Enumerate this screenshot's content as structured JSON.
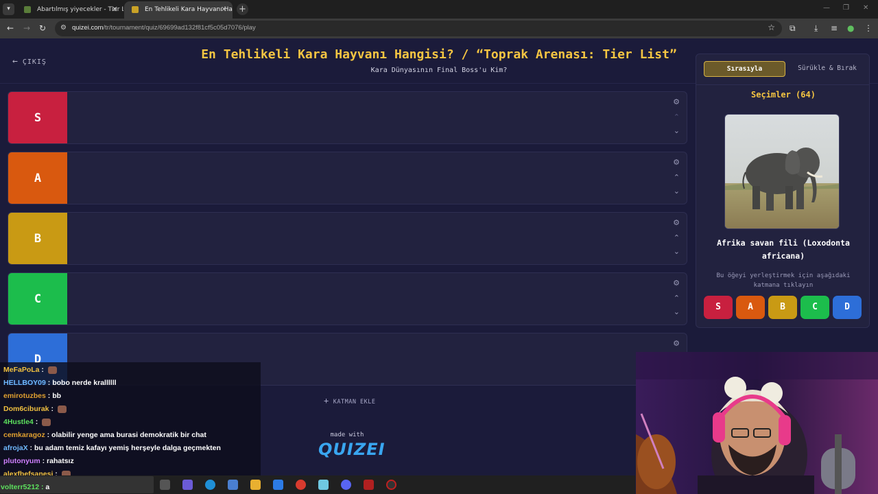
{
  "browser": {
    "tabs": [
      {
        "title": "Abartılmış yiyecekler - Tier List |"
      },
      {
        "title": "En Tehlikeli Kara Hayvanı Hangi"
      }
    ],
    "url_domain": "quizei.com",
    "url_path": "/tr/tournament/quiz/69699ad132f81cf5c05d7076/play"
  },
  "header": {
    "exit_label": "ÇIKIŞ",
    "title": "En Tehlikeli Kara Hayvanı Hangisi? / “Toprak Arenası: Tier List”",
    "subtitle": "Kara Dünyasının Final Boss'u Kim?"
  },
  "tiers": [
    {
      "label": "S",
      "color": "#c8203f"
    },
    {
      "label": "A",
      "color": "#d9590f"
    },
    {
      "label": "B",
      "color": "#c99a14"
    },
    {
      "label": "C",
      "color": "#1cbd4c"
    },
    {
      "label": "D",
      "color": "#2d6ed8"
    }
  ],
  "add_layer_label": "KATMAN EKLE",
  "made_with": "made with",
  "brand": "QUIZEI",
  "panel": {
    "tab_ordered": "Sırasıyla",
    "tab_drag": "Sürükle & Bırak",
    "selections_heading": "Seçimler (64)",
    "item_name": "Afrika savan fili (Loxodonta africana)",
    "hint": "Bu öğeyi yerleştirmek için aşağıdaki katmana tıklayın",
    "tier_buttons": [
      "S",
      "A",
      "B",
      "C",
      "D"
    ]
  },
  "chat": [
    {
      "user": "MeFaPoLa",
      "color": "#f0c040",
      "text": "",
      "emote": true
    },
    {
      "user": "HELLBOY09",
      "color": "#6fb8ff",
      "text": "bobo nerde krallllll",
      "emote": false
    },
    {
      "user": "emirotuzbes",
      "color": "#e0a030",
      "text": "bb",
      "emote": false
    },
    {
      "user": "Dom6ciburak",
      "color": "#f0c040",
      "text": "",
      "emote": true
    },
    {
      "user": "4Hustle4",
      "color": "#5de05d",
      "text": "",
      "emote": true
    },
    {
      "user": "cemkaragoz",
      "color": "#e0a030",
      "text": "olabilir yenge ama burasi demokratik bir chat",
      "emote": false
    },
    {
      "user": "afrojaX",
      "color": "#6fb8ff",
      "text": "bu adam temiz kafayı yemiş herşeyle dalga geçmekten",
      "emote": false
    },
    {
      "user": "plutonyum",
      "color": "#d080ff",
      "text": "rahatsız",
      "emote": false
    },
    {
      "user": "alexfbefsanesi",
      "color": "#f0c040",
      "text": "",
      "emote": true
    }
  ],
  "chat_bottom_user": "volterr5212",
  "chat_bottom_text": "a"
}
